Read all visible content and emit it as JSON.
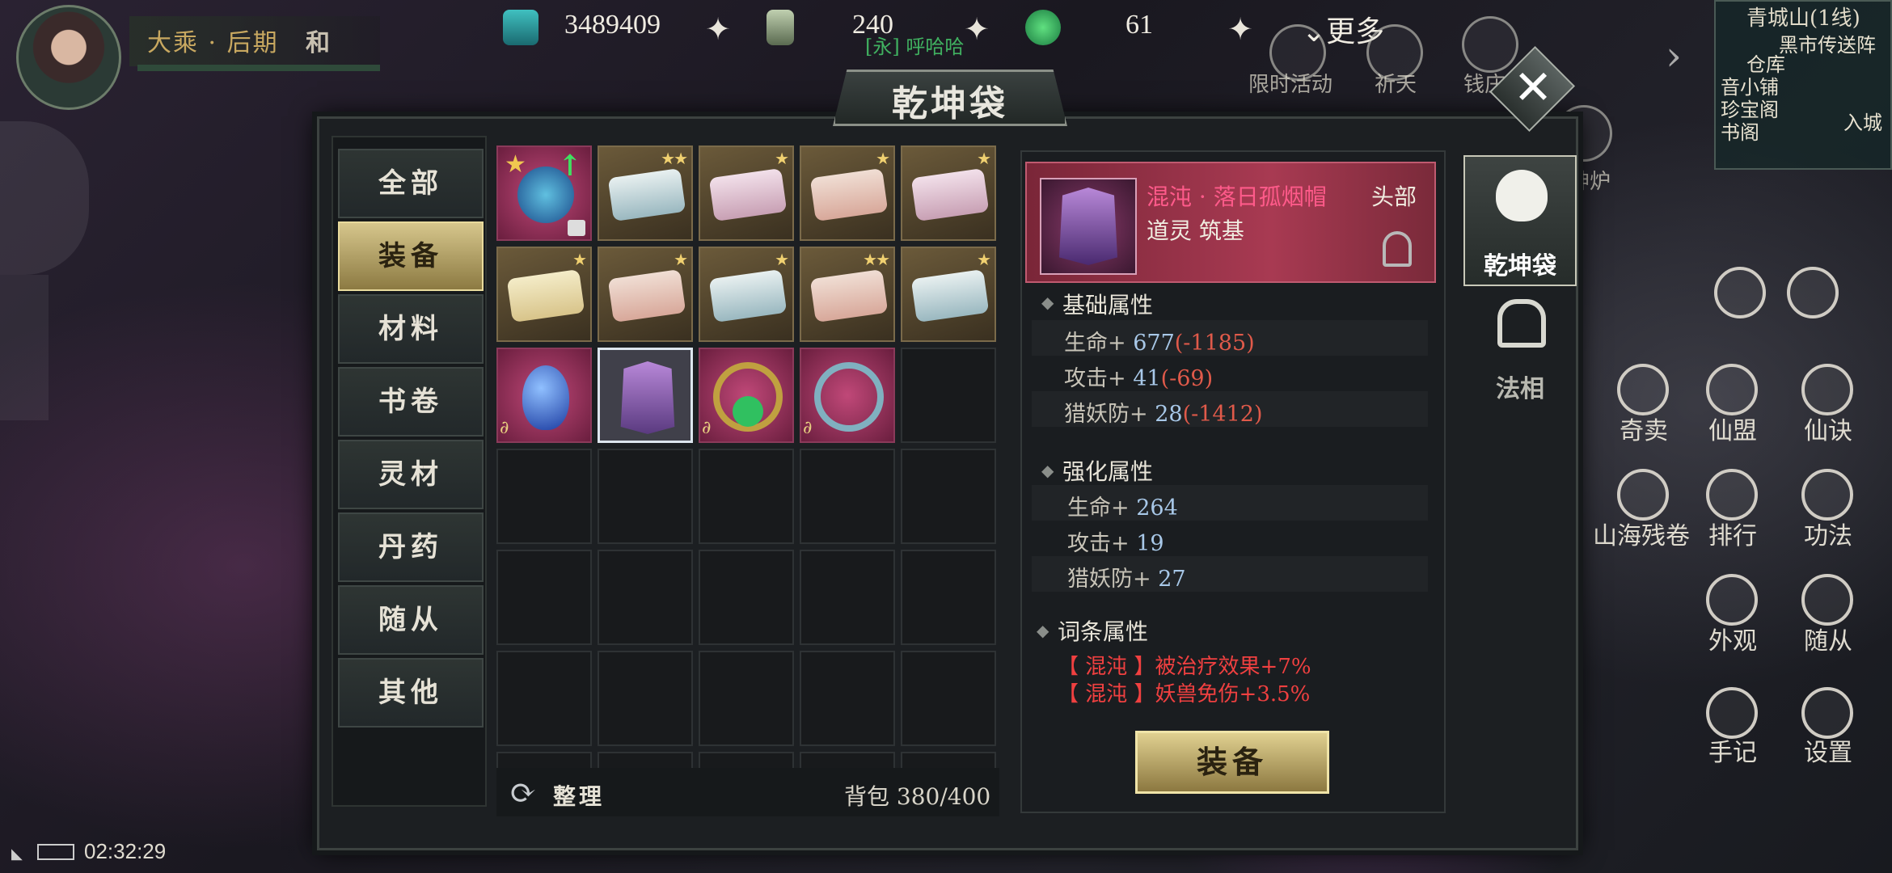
{
  "header": {
    "level_text": "大乘 · 后期",
    "level_extra": "和",
    "currencies": [
      {
        "icon": "spirit-stone-icon",
        "value": "3489409"
      },
      {
        "icon": "jade-token-icon",
        "value": "240"
      },
      {
        "icon": "jade-coin-icon",
        "value": "61"
      }
    ],
    "more_label": "更多",
    "chat_snippet": "[永] 呼哈哈"
  },
  "behind_icons": [
    {
      "label": "限时活动"
    },
    {
      "label": "祈天"
    },
    {
      "label": "钱庄"
    },
    {
      "label": "神炉"
    }
  ],
  "minimap": {
    "title": "青城山(1线)",
    "labels": [
      "黑市传送阵",
      "仓库",
      "音小铺",
      "珍宝阁",
      "书阁",
      "入城"
    ]
  },
  "panel": {
    "title": "乾坤袋"
  },
  "categories": [
    {
      "label": "全部"
    },
    {
      "label": "装备"
    },
    {
      "label": "材料"
    },
    {
      "label": "书卷"
    },
    {
      "label": "灵材"
    },
    {
      "label": "丹药"
    },
    {
      "label": "随从"
    },
    {
      "label": "其他"
    }
  ],
  "active_category": "装备",
  "bag": {
    "sort_label": "整理",
    "capacity_label": "背包 380/400"
  },
  "item_detail": {
    "name": "混沌 · 落日孤烟帽",
    "slot": "头部",
    "requirement": "道灵 筑基",
    "base_title": "基础属性",
    "base_attrs": [
      {
        "label": "生命+",
        "value": "677",
        "diff": "(-1185)"
      },
      {
        "label": "攻击+",
        "value": "41",
        "diff": "(-69)"
      },
      {
        "label": "猎妖防+",
        "value": "28",
        "diff": "(-1412)"
      }
    ],
    "enhance_title": "强化属性",
    "enhance_attrs": [
      {
        "label": "生命+",
        "value": "264"
      },
      {
        "label": "攻击+",
        "value": "19"
      },
      {
        "label": "猎妖防+",
        "value": "27"
      }
    ],
    "affix_title": "词条属性",
    "affixes": [
      "【 混沌 】被治疗效果+7%",
      "【 混沌 】妖兽免伤+3.5%"
    ],
    "equip_label": "装备"
  },
  "side_tabs": [
    {
      "label": "乾坤袋"
    },
    {
      "label": "法相"
    }
  ],
  "right_menu": [
    {
      "label": "奇卖"
    },
    {
      "label": "仙盟"
    },
    {
      "label": "仙诀"
    },
    {
      "label": "山海残卷"
    },
    {
      "label": "排行"
    },
    {
      "label": "功法"
    },
    {
      "label": "外观"
    },
    {
      "label": "随从"
    },
    {
      "label": "手记"
    },
    {
      "label": "设置"
    }
  ],
  "status": {
    "time": "02:32:29"
  }
}
